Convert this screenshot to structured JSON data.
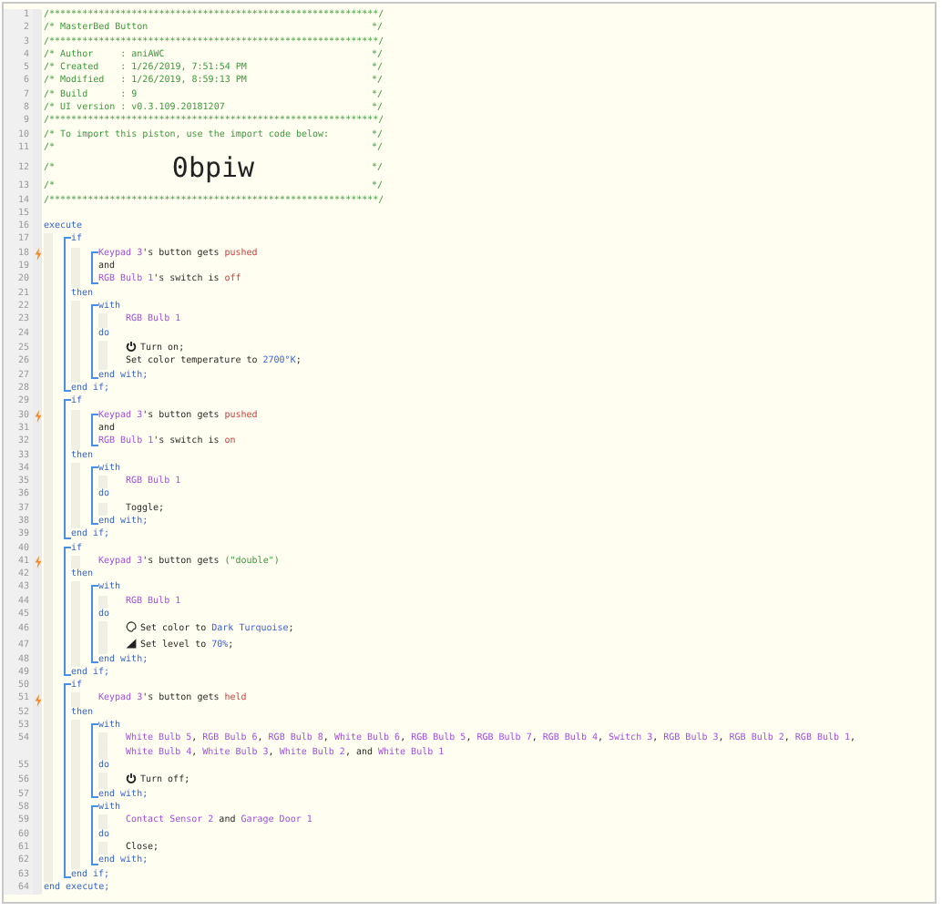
{
  "lines": [
    {
      "no": "1",
      "trigger": false,
      "parts": [
        {
          "t": "/************************************************************/",
          "kind": "cmt"
        }
      ]
    },
    {
      "no": "2",
      "trigger": false,
      "parts": [
        {
          "t": "/* MasterBed Button",
          "kind": "cmt"
        },
        {
          "t": "*/",
          "kind": "end"
        }
      ]
    },
    {
      "no": "3",
      "trigger": false,
      "parts": [
        {
          "t": "/************************************************************/",
          "kind": "cmt"
        }
      ]
    },
    {
      "no": "4",
      "trigger": false,
      "parts": [
        {
          "t": "/* Author     : aniAWC",
          "kind": "cmt"
        },
        {
          "t": "*/",
          "kind": "end"
        }
      ]
    },
    {
      "no": "5",
      "trigger": false,
      "parts": [
        {
          "t": "/* Created    : 1/26/2019, 7:51:54 PM",
          "kind": "cmt"
        },
        {
          "t": "*/",
          "kind": "end"
        }
      ]
    },
    {
      "no": "6",
      "trigger": false,
      "parts": [
        {
          "t": "/* Modified   : 1/26/2019, 8:59:13 PM",
          "kind": "cmt"
        },
        {
          "t": "*/",
          "kind": "end"
        }
      ]
    },
    {
      "no": "7",
      "trigger": false,
      "parts": [
        {
          "t": "/* Build      : 9",
          "kind": "cmt"
        },
        {
          "t": "*/",
          "kind": "end"
        }
      ]
    },
    {
      "no": "8",
      "trigger": false,
      "parts": [
        {
          "t": "/* UI version : v0.3.109.20181207",
          "kind": "cmt"
        },
        {
          "t": "*/",
          "kind": "end"
        }
      ]
    },
    {
      "no": "9",
      "trigger": false,
      "parts": [
        {
          "t": "/************************************************************/",
          "kind": "cmt"
        }
      ]
    },
    {
      "no": "10",
      "trigger": false,
      "parts": [
        {
          "t": "/* To import this piston, use the import code below:",
          "kind": "cmt"
        },
        {
          "t": "*/",
          "kind": "end"
        }
      ]
    },
    {
      "no": "11",
      "trigger": false,
      "parts": [
        {
          "t": "/*",
          "kind": "cmt"
        },
        {
          "t": "*/",
          "kind": "end"
        }
      ]
    },
    {
      "no": "12",
      "trigger": false,
      "parts": [
        {
          "t": "/*",
          "kind": "cmt"
        },
        {
          "t": "0bpiw",
          "kind": "big"
        },
        {
          "t": "*/",
          "kind": "end"
        }
      ]
    },
    {
      "no": "13",
      "trigger": false,
      "parts": [
        {
          "t": "/*",
          "kind": "cmt"
        },
        {
          "t": "*/",
          "kind": "end"
        }
      ]
    },
    {
      "no": "14",
      "trigger": false,
      "parts": [
        {
          "t": "/************************************************************/",
          "kind": "cmt"
        }
      ]
    },
    {
      "no": "15",
      "trigger": false
    },
    {
      "no": "16",
      "trigger": false,
      "parts": [
        {
          "t": "execute",
          "kind": "kw"
        }
      ],
      "children": [
        {
          "block": [
            {
              "no": "17",
              "trigger": false,
              "parts": [
                {
                  "t": "if",
                  "kind": "kw"
                }
              ],
              "children": [
                {
                  "block": [
                    {
                      "no": "18",
                      "trigger": true,
                      "parts": [
                        {
                          "t": "Keypad 3",
                          "kind": "dev"
                        },
                        {
                          "t": "'s button gets ",
                          "kind": "txt"
                        },
                        {
                          "t": "pushed",
                          "kind": "val"
                        }
                      ]
                    },
                    {
                      "no": "19",
                      "trigger": false,
                      "parts": [
                        {
                          "t": "and",
                          "kind": "txt"
                        }
                      ]
                    },
                    {
                      "no": "20",
                      "trigger": false,
                      "parts": [
                        {
                          "t": "RGB Bulb 1",
                          "kind": "dev"
                        },
                        {
                          "t": "'s switch is ",
                          "kind": "txt"
                        },
                        {
                          "t": "off",
                          "kind": "val"
                        }
                      ]
                    }
                  ]
                }
              ]
            },
            {
              "no": "21",
              "trigger": false,
              "parts": [
                {
                  "t": "then",
                  "kind": "kw"
                }
              ],
              "children": [
                {
                  "block": [
                    {
                      "no": "22",
                      "trigger": false,
                      "parts": [
                        {
                          "t": "with",
                          "kind": "kw"
                        }
                      ],
                      "children": [
                        {
                          "no": "23",
                          "trigger": false,
                          "parts": [
                            {
                              "t": "RGB Bulb 1",
                              "kind": "dev"
                            }
                          ]
                        }
                      ]
                    },
                    {
                      "no": "24",
                      "trigger": false,
                      "parts": [
                        {
                          "t": "do",
                          "kind": "kw"
                        }
                      ],
                      "children": [
                        {
                          "no": "25",
                          "trigger": false,
                          "kind": "switch",
                          "parts": [
                            {
                              "t": "Turn on;",
                              "kind": "txt"
                            }
                          ]
                        },
                        {
                          "no": "26",
                          "trigger": false,
                          "parts": [
                            {
                              "t": "Set color temperature to ",
                              "kind": "txt"
                            },
                            {
                              "t": "2700°K",
                              "kind": "num"
                            },
                            {
                              "t": ";",
                              "kind": "txt"
                            }
                          ]
                        }
                      ]
                    },
                    {
                      "no": "27",
                      "trigger": false,
                      "parts": [
                        {
                          "t": "end with;",
                          "kind": "kw"
                        }
                      ]
                    }
                  ]
                }
              ]
            },
            {
              "no": "28",
              "trigger": false,
              "parts": [
                {
                  "t": "end if;",
                  "kind": "kw"
                }
              ]
            }
          ]
        },
        {
          "block": [
            {
              "no": "29",
              "trigger": false,
              "parts": [
                {
                  "t": "if",
                  "kind": "kw"
                }
              ],
              "children": [
                {
                  "block": [
                    {
                      "no": "30",
                      "trigger": true,
                      "parts": [
                        {
                          "t": "Keypad 3",
                          "kind": "dev"
                        },
                        {
                          "t": "'s button gets ",
                          "kind": "txt"
                        },
                        {
                          "t": "pushed",
                          "kind": "val"
                        }
                      ]
                    },
                    {
                      "no": "31",
                      "trigger": false,
                      "parts": [
                        {
                          "t": "and",
                          "kind": "txt"
                        }
                      ]
                    },
                    {
                      "no": "32",
                      "trigger": false,
                      "parts": [
                        {
                          "t": "RGB Bulb 1",
                          "kind": "dev"
                        },
                        {
                          "t": "'s switch is ",
                          "kind": "txt"
                        },
                        {
                          "t": "on",
                          "kind": "val"
                        }
                      ]
                    }
                  ]
                }
              ]
            },
            {
              "no": "33",
              "trigger": false,
              "parts": [
                {
                  "t": "then",
                  "kind": "kw"
                }
              ],
              "children": [
                {
                  "block": [
                    {
                      "no": "34",
                      "trigger": false,
                      "parts": [
                        {
                          "t": "with",
                          "kind": "kw"
                        }
                      ],
                      "children": [
                        {
                          "no": "35",
                          "trigger": false,
                          "parts": [
                            {
                              "t": "RGB Bulb 1",
                              "kind": "dev"
                            }
                          ]
                        }
                      ]
                    },
                    {
                      "no": "36",
                      "trigger": false,
                      "parts": [
                        {
                          "t": "do",
                          "kind": "kw"
                        }
                      ],
                      "children": [
                        {
                          "no": "37",
                          "trigger": false,
                          "parts": [
                            {
                              "t": "Toggle;",
                              "kind": "txt"
                            }
                          ]
                        }
                      ]
                    },
                    {
                      "no": "38",
                      "trigger": false,
                      "parts": [
                        {
                          "t": "end with;",
                          "kind": "kw"
                        }
                      ]
                    }
                  ]
                }
              ]
            },
            {
              "no": "39",
              "trigger": false,
              "parts": [
                {
                  "t": "end if;",
                  "kind": "kw"
                }
              ]
            }
          ]
        },
        {
          "block": [
            {
              "no": "40",
              "trigger": false,
              "parts": [
                {
                  "t": "if",
                  "kind": "kw"
                }
              ],
              "children": [
                {
                  "no": "41",
                  "trigger": true,
                  "parts": [
                    {
                      "t": "Keypad 3",
                      "kind": "dev"
                    },
                    {
                      "t": "'s button gets ",
                      "kind": "txt"
                    },
                    {
                      "t": "(\"double\")",
                      "kind": "str"
                    }
                  ]
                }
              ]
            },
            {
              "no": "42",
              "trigger": false,
              "parts": [
                {
                  "t": "then",
                  "kind": "kw"
                }
              ],
              "children": [
                {
                  "block": [
                    {
                      "no": "43",
                      "trigger": false,
                      "parts": [
                        {
                          "t": "with",
                          "kind": "kw"
                        }
                      ],
                      "children": [
                        {
                          "no": "44",
                          "trigger": false,
                          "parts": [
                            {
                              "t": "RGB Bulb 1",
                              "kind": "dev"
                            }
                          ]
                        }
                      ]
                    },
                    {
                      "no": "45",
                      "trigger": false,
                      "parts": [
                        {
                          "t": "do",
                          "kind": "kw"
                        }
                      ],
                      "children": [
                        {
                          "no": "46",
                          "trigger": false,
                          "kind": "color",
                          "parts": [
                            {
                              "t": "Set color to ",
                              "kind": "txt"
                            },
                            {
                              "t": "Dark Turquoise",
                              "kind": "num"
                            },
                            {
                              "t": ";",
                              "kind": "txt"
                            }
                          ]
                        },
                        {
                          "no": "47",
                          "trigger": false,
                          "kind": "level",
                          "parts": [
                            {
                              "t": "Set level to ",
                              "kind": "txt"
                            },
                            {
                              "t": "70%",
                              "kind": "num"
                            },
                            {
                              "t": ";",
                              "kind": "txt"
                            }
                          ]
                        }
                      ]
                    },
                    {
                      "no": "48",
                      "trigger": false,
                      "parts": [
                        {
                          "t": "end with;",
                          "kind": "kw"
                        }
                      ]
                    }
                  ]
                }
              ]
            },
            {
              "no": "49",
              "trigger": false,
              "parts": [
                {
                  "t": "end if;",
                  "kind": "kw"
                }
              ]
            }
          ]
        },
        {
          "block": [
            {
              "no": "50",
              "trigger": false,
              "parts": [
                {
                  "t": "if",
                  "kind": "kw"
                }
              ],
              "children": [
                {
                  "no": "51",
                  "trigger": true,
                  "parts": [
                    {
                      "t": "Keypad 3",
                      "kind": "dev"
                    },
                    {
                      "t": "'s button gets ",
                      "kind": "txt"
                    },
                    {
                      "t": "held",
                      "kind": "val"
                    }
                  ]
                }
              ]
            },
            {
              "no": "52",
              "trigger": false,
              "parts": [
                {
                  "t": "then",
                  "kind": "kw"
                }
              ],
              "children": [
                {
                  "block": [
                    {
                      "no": "53",
                      "trigger": false,
                      "parts": [
                        {
                          "t": "with",
                          "kind": "kw"
                        }
                      ],
                      "children": [
                        {
                          "no": "54",
                          "trigger": false,
                          "parts": [
                            {
                              "t": "White Bulb 5",
                              "kind": "dev"
                            },
                            {
                              "t": ", ",
                              "kind": "txt"
                            },
                            {
                              "t": "RGB Bulb 6",
                              "kind": "dev"
                            },
                            {
                              "t": ", ",
                              "kind": "txt"
                            },
                            {
                              "t": "RGB Bulb 8",
                              "kind": "dev"
                            },
                            {
                              "t": ", ",
                              "kind": "txt"
                            },
                            {
                              "t": "White Bulb 6",
                              "kind": "dev"
                            },
                            {
                              "t": ", ",
                              "kind": "txt"
                            },
                            {
                              "t": "RGB Bulb 5",
                              "kind": "dev"
                            },
                            {
                              "t": ", ",
                              "kind": "txt"
                            },
                            {
                              "t": "RGB Bulb 7",
                              "kind": "dev"
                            },
                            {
                              "t": ", ",
                              "kind": "txt"
                            },
                            {
                              "t": "RGB Bulb 4",
                              "kind": "dev"
                            },
                            {
                              "t": ", ",
                              "kind": "txt"
                            },
                            {
                              "t": "Switch 3",
                              "kind": "dev"
                            },
                            {
                              "t": ", ",
                              "kind": "txt"
                            },
                            {
                              "t": "RGB Bulb 3",
                              "kind": "dev"
                            },
                            {
                              "t": ", ",
                              "kind": "txt"
                            },
                            {
                              "t": "RGB Bulb 2",
                              "kind": "dev"
                            },
                            {
                              "t": ", ",
                              "kind": "txt"
                            },
                            {
                              "t": "RGB Bulb 1",
                              "kind": "dev"
                            },
                            {
                              "t": ", ",
                              "kind": "txt"
                            },
                            {
                              "t": "White Bulb 4",
                              "kind": "dev"
                            },
                            {
                              "t": ", ",
                              "kind": "txt"
                            },
                            {
                              "t": "White Bulb 3",
                              "kind": "dev"
                            },
                            {
                              "t": ", ",
                              "kind": "txt"
                            },
                            {
                              "t": "White Bulb 2",
                              "kind": "dev"
                            },
                            {
                              "t": ", and ",
                              "kind": "txt"
                            },
                            {
                              "t": "White Bulb 1",
                              "kind": "dev"
                            }
                          ]
                        }
                      ]
                    },
                    {
                      "no": "55",
                      "trigger": false,
                      "parts": [
                        {
                          "t": "do",
                          "kind": "kw"
                        }
                      ],
                      "children": [
                        {
                          "no": "56",
                          "trigger": false,
                          "kind": "switch",
                          "parts": [
                            {
                              "t": "Turn off;",
                              "kind": "txt"
                            }
                          ]
                        }
                      ]
                    },
                    {
                      "no": "57",
                      "trigger": false,
                      "parts": [
                        {
                          "t": "end with;",
                          "kind": "kw"
                        }
                      ]
                    }
                  ]
                },
                {
                  "block": [
                    {
                      "no": "58",
                      "trigger": false,
                      "parts": [
                        {
                          "t": "with",
                          "kind": "kw"
                        }
                      ],
                      "children": [
                        {
                          "no": "59",
                          "trigger": false,
                          "parts": [
                            {
                              "t": "Contact Sensor 2",
                              "kind": "dev"
                            },
                            {
                              "t": " and ",
                              "kind": "txt"
                            },
                            {
                              "t": "Garage Door 1",
                              "kind": "dev"
                            }
                          ]
                        }
                      ]
                    },
                    {
                      "no": "60",
                      "trigger": false,
                      "parts": [
                        {
                          "t": "do",
                          "kind": "kw"
                        }
                      ],
                      "children": [
                        {
                          "no": "61",
                          "trigger": false,
                          "parts": [
                            {
                              "t": "Close;",
                              "kind": "txt"
                            }
                          ]
                        }
                      ]
                    },
                    {
                      "no": "62",
                      "trigger": false,
                      "parts": [
                        {
                          "t": "end with;",
                          "kind": "kw"
                        }
                      ]
                    }
                  ]
                }
              ]
            },
            {
              "no": "63",
              "trigger": false,
              "parts": [
                {
                  "t": "end if;",
                  "kind": "kw"
                }
              ]
            }
          ]
        }
      ]
    },
    {
      "no": "64",
      "trigger": false,
      "parts": [
        {
          "t": "end execute;",
          "kind": "kw"
        }
      ]
    }
  ]
}
